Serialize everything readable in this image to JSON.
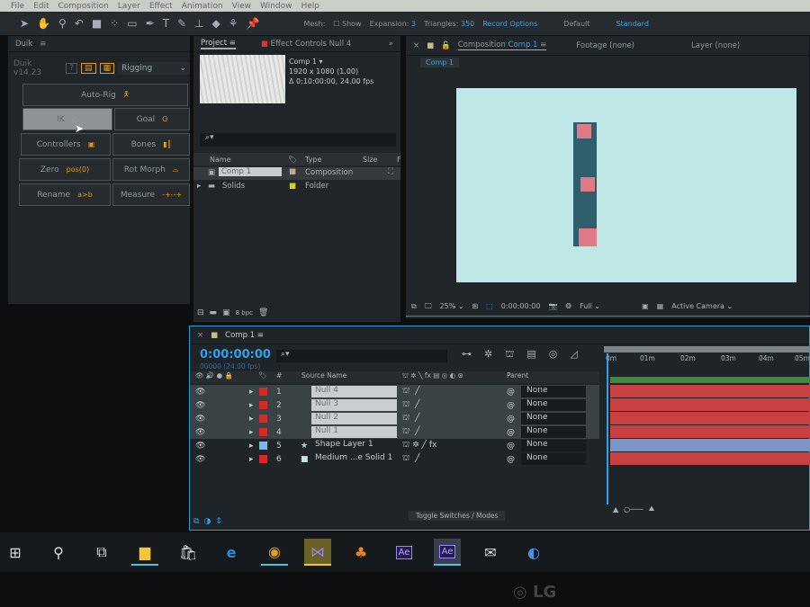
{
  "menu": [
    "File",
    "Edit",
    "Composition",
    "Layer",
    "Effect",
    "Animation",
    "View",
    "Window",
    "Help"
  ],
  "toolbar": {
    "mesh_label": "Mesh:",
    "show_label": "Show",
    "expansion_label": "Expansion:",
    "expansion": "3",
    "triangles_label": "Triangles:",
    "triangles": "350",
    "record_options": "Record Options",
    "workspace_default": "Default",
    "workspace_standard": "Standard"
  },
  "duik": {
    "tab": "Duik",
    "version": "Duik v14.23",
    "help": "?",
    "mode": "Rigging",
    "buttons": [
      {
        "label": "Auto-Rig",
        "icon": "person-icon"
      },
      {
        "label": "IK",
        "icon": "ik-icon"
      },
      {
        "label": "Goal",
        "icon": "foot-icon"
      },
      {
        "label": "Controllers",
        "icon": "controller-icon"
      },
      {
        "label": "Bones",
        "icon": "bones-icon"
      },
      {
        "label": "Zero",
        "icon_text": "pos(0)"
      },
      {
        "label": "Rot Morph",
        "icon": "rotmorph-icon"
      },
      {
        "label": "Rename",
        "icon_text": "a>b"
      },
      {
        "label": "Measure",
        "icon_text": "-+--+"
      }
    ]
  },
  "project": {
    "tab": "Project",
    "effect_controls_tab": "Effect Controls Null 4",
    "comp_name": "Comp 1 ▾",
    "comp_size": "1920 x 1080 (1.00)",
    "comp_duration": "Δ 0:10:00:00, 24.00 fps",
    "columns": [
      "Name",
      "Type",
      "Size",
      "F"
    ],
    "items": [
      {
        "name": "Comp 1",
        "type": "Composition",
        "color": "#b8ac88"
      },
      {
        "name": "Solids",
        "type": "Folder",
        "color": "#d6d01a"
      }
    ],
    "bpc": "8 bpc"
  },
  "composition": {
    "tab_prefix": "Composition",
    "tab_name": "Comp 1",
    "footage_tab": "Footage (none)",
    "layer_tab": "Layer (none)",
    "breadcrumb": "Comp 1",
    "zoom": "25%",
    "timecode": "0:00:00:00",
    "resolution": "Full",
    "camera": "Active Camera"
  },
  "timeline": {
    "tab": "Comp 1",
    "timecode": "0:00:00:00",
    "frames": "00000 (24.00 fps)",
    "col_source": "Source Name",
    "col_parent": "Parent",
    "col_num": "#",
    "ruler": [
      "0m",
      "01m",
      "02m",
      "03m",
      "04m",
      "05m"
    ],
    "toggle": "Toggle Switches / Modes",
    "layers": [
      {
        "num": "1",
        "name": "Null 4",
        "color": "#d42a2a",
        "parent": "None",
        "bar": "#c94040",
        "type": "null"
      },
      {
        "num": "2",
        "name": "Null 3",
        "color": "#d42a2a",
        "parent": "None",
        "bar": "#c94040",
        "type": "null"
      },
      {
        "num": "3",
        "name": "Null 2",
        "color": "#d42a2a",
        "parent": "None",
        "bar": "#c94040",
        "type": "null"
      },
      {
        "num": "4",
        "name": "Null 1",
        "color": "#d42a2a",
        "parent": "None",
        "bar": "#c94040",
        "type": "null"
      },
      {
        "num": "5",
        "name": "Shape Layer 1",
        "color": "#7fb6e8",
        "parent": "None",
        "bar": "#7b95c4",
        "type": "shape"
      },
      {
        "num": "6",
        "name": "Medium ...e Solid 1",
        "color": "#d42a2a",
        "parent": "None",
        "bar": "#c94040",
        "type": "solid"
      }
    ]
  },
  "taskbar": [
    "start-icon",
    "search-icon",
    "task-view-icon",
    "file-explorer-icon",
    "store-icon",
    "edge-icon",
    "chrome-icon",
    "visual-studio-icon",
    "fl-studio-icon",
    "after-effects-icon",
    "after-effects-icon",
    "mail-icon",
    "cinema4d-icon"
  ],
  "ae_label": "Ae",
  "monitor_brand": "LG"
}
